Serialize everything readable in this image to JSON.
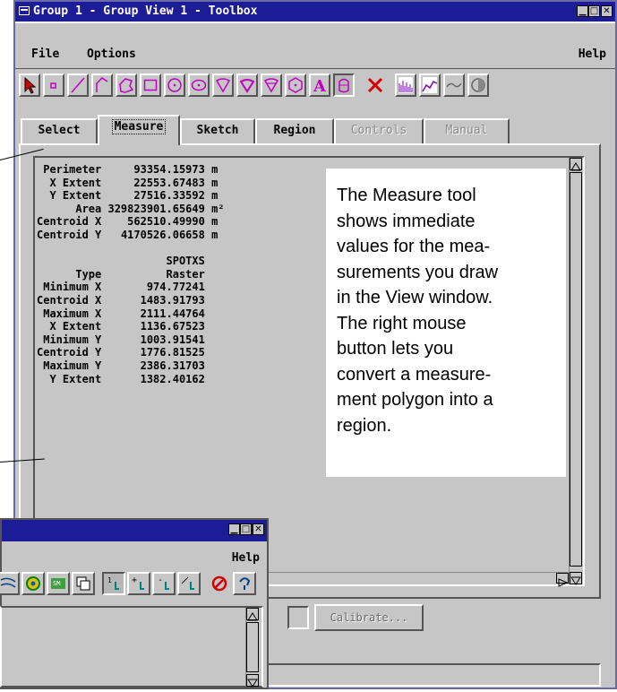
{
  "window": {
    "title": "Group 1 - Group View 1 - Toolbox",
    "menus": [
      "File",
      "Options"
    ],
    "help": "Help"
  },
  "toolbar": {
    "tools": [
      "select-arrow",
      "point",
      "line",
      "polyline",
      "freehand-polygon",
      "rectangle",
      "circle",
      "ellipse",
      "wedge",
      "filled-wedge",
      "region-tool",
      "hexagon",
      "text",
      "bucket",
      "delete-x",
      "histogram",
      "profile",
      "curve",
      "contrast"
    ]
  },
  "tabs": [
    {
      "label": "Select",
      "state": "normal"
    },
    {
      "label": "Measure",
      "state": "active"
    },
    {
      "label": "Sketch",
      "state": "normal"
    },
    {
      "label": "Region",
      "state": "normal"
    },
    {
      "label": "Controls",
      "state": "disabled"
    },
    {
      "label": "Manual",
      "state": "disabled"
    }
  ],
  "measurements": {
    "geometry": [
      {
        "label": "Perimeter",
        "value": "93354.15973",
        "unit": "m"
      },
      {
        "label": "X Extent",
        "value": "22553.67483",
        "unit": "m"
      },
      {
        "label": "Y Extent",
        "value": "27516.33592",
        "unit": "m"
      },
      {
        "label": "Area",
        "value": "329823901.65649",
        "unit": "m²"
      },
      {
        "label": "Centroid X",
        "value": "562510.49990",
        "unit": "m"
      },
      {
        "label": "Centroid Y",
        "value": "4170526.06658",
        "unit": "m"
      }
    ],
    "layer_name": "SPOTXS",
    "raster": [
      {
        "label": "Type",
        "value": "Raster"
      },
      {
        "label": "Minimum X",
        "value": "974.77241"
      },
      {
        "label": "Centroid X",
        "value": "1483.91793"
      },
      {
        "label": "Maximum X",
        "value": "2111.44764"
      },
      {
        "label": "X Extent",
        "value": "1136.67523"
      },
      {
        "label": "Minimum Y",
        "value": "1003.91541"
      },
      {
        "label": "Centroid Y",
        "value": "1776.81525"
      },
      {
        "label": "Maximum Y",
        "value": "2386.31703"
      },
      {
        "label": "Y Extent",
        "value": "1382.40162"
      }
    ]
  },
  "bottom": {
    "calibrate": "Calibrate..."
  },
  "note": "The Measure tool shows immediate values for the mea- surements you draw in the View window. The right mouse button lets you convert a measure- ment polygon into a region.",
  "note_lines": [
    "The Measure tool",
    "shows immediate",
    "values for the mea-",
    "surements you draw",
    "in the View window.",
    "The right mouse",
    "button lets you",
    "convert a measure-",
    "ment polygon into a",
    "region."
  ],
  "second_window": {
    "help": "Help",
    "tools": [
      "grid-lines",
      "color-wheel",
      "palette",
      "copy",
      "position-1",
      "add-point",
      "remove-point",
      "edit-point",
      "no-entry",
      "undo-arrow"
    ]
  }
}
